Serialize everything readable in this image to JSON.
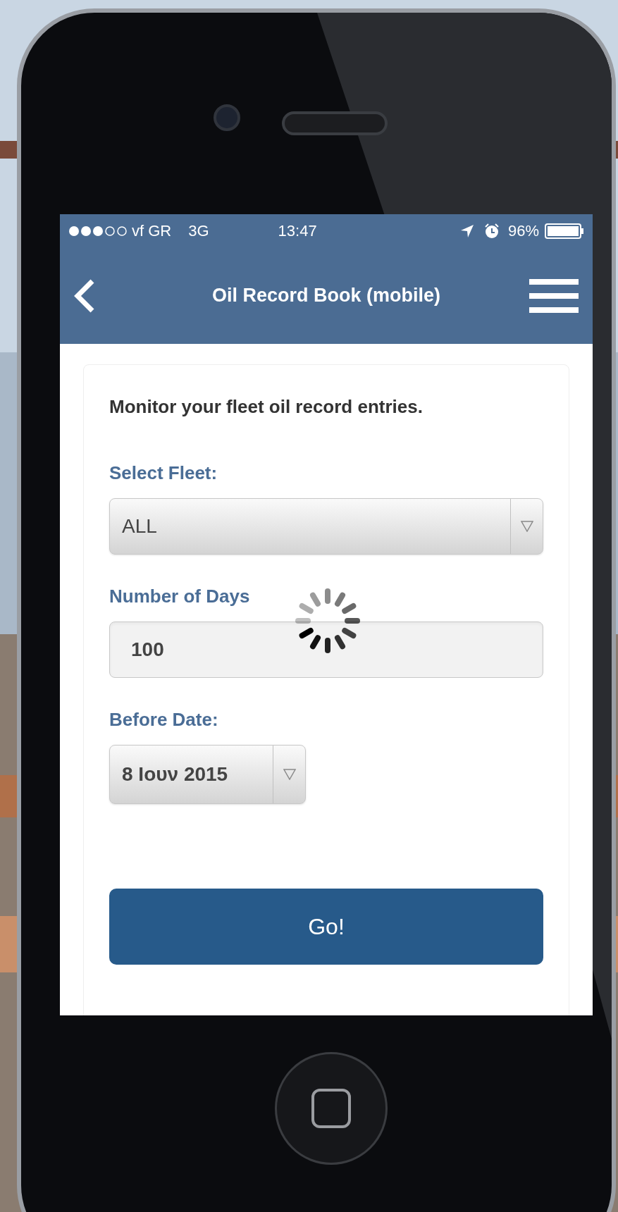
{
  "status_bar": {
    "carrier": "vf GR",
    "network": "3G",
    "time": "13:47",
    "battery": "96%"
  },
  "nav": {
    "title": "Oil Record Book (mobile)"
  },
  "form": {
    "intro": "Monitor your fleet oil record entries.",
    "fields": [
      {
        "kind": "select",
        "label": "Select Fleet:",
        "value": "ALL"
      },
      {
        "kind": "input",
        "label": "Number of Days",
        "value": "100"
      },
      {
        "kind": "date",
        "label": "Before Date:",
        "value": "8 Ιουν 2015"
      }
    ],
    "submit": "Go!"
  },
  "loading": true
}
